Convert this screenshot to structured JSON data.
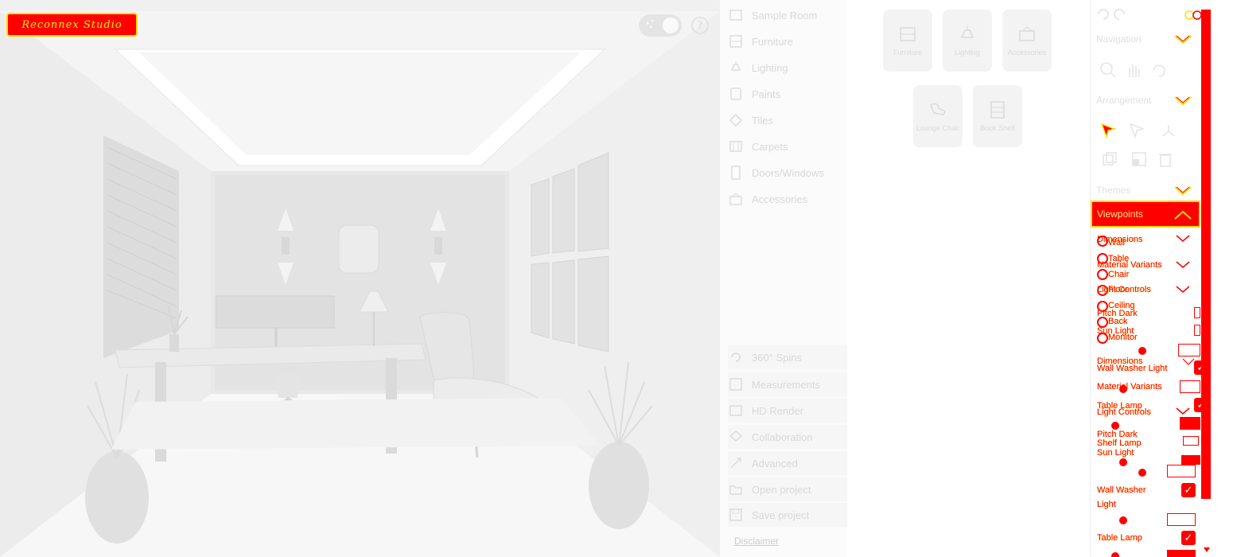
{
  "viewport": {
    "logo_text": "Reconnex Studio"
  },
  "categories": [
    {
      "label": "Sample Room",
      "icon": "sample-room-icon"
    },
    {
      "label": "Furniture",
      "icon": "furniture-icon"
    },
    {
      "label": "Lighting",
      "icon": "lighting-icon"
    },
    {
      "label": "Paints",
      "icon": "paints-icon"
    },
    {
      "label": "Tiles",
      "icon": "tiles-icon"
    },
    {
      "label": "Carpets",
      "icon": "carpets-icon"
    },
    {
      "label": "Doors/Windows",
      "icon": "doors-windows-icon"
    },
    {
      "label": "Accessories",
      "icon": "accessories-icon"
    }
  ],
  "tools": [
    {
      "label": "360° Spins",
      "icon": "spin-icon"
    },
    {
      "label": "Measurements",
      "icon": "measurements-icon"
    },
    {
      "label": "HD Render",
      "icon": "hd-render-icon"
    },
    {
      "label": "Collaboration",
      "icon": "collaboration-icon"
    },
    {
      "label": "Advanced",
      "icon": "advanced-icon"
    },
    {
      "label": "Open project",
      "icon": "open-project-icon"
    },
    {
      "label": "Save project",
      "icon": "save-project-icon"
    }
  ],
  "disclaimer": "Disclaimer",
  "products": [
    {
      "label": "Furniture"
    },
    {
      "label": "Lighting"
    },
    {
      "label": "Accessories"
    },
    {
      "label": "Lounge Chair"
    },
    {
      "label": "Book Shelf"
    }
  ],
  "panel": {
    "navigation": "Navigation",
    "arrangement": "Arrangement",
    "themes": "Themes",
    "viewpoints": "Viewpoints",
    "dimensions": "Dimensions",
    "material_variants": "Material Variants",
    "light_controls": "Light Controls",
    "viewpoint_options": [
      "Wall",
      "Table",
      "Chair",
      "Floor",
      "Ceiling",
      "Back",
      "Monitor"
    ],
    "light_options": [
      "Pitch Dark",
      "Sun Light",
      "Wall Washer Light",
      "Table Lamp",
      "Shelf Lamp"
    ],
    "wall_washer_line1": "Wall Washer",
    "wall_washer_line2": "Light",
    "table_lamp": "Table Lamp"
  },
  "colors": {
    "accent": "#ff0000",
    "outline": "#ffdd00",
    "muted_text": "#d8d8d8"
  }
}
